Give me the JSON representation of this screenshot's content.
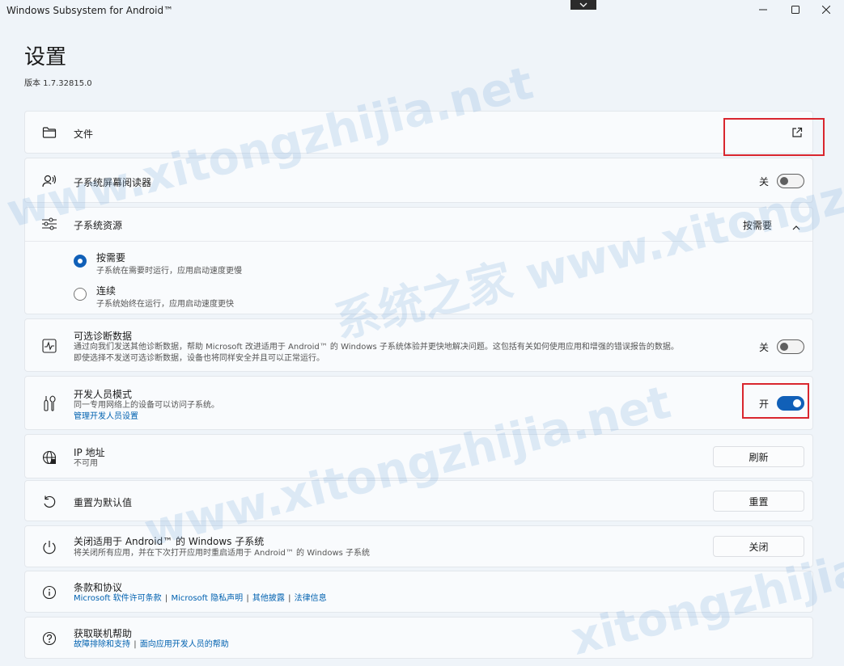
{
  "window": {
    "title": "Windows Subsystem for Android™",
    "controls": [
      "minimize-icon",
      "maximize-icon",
      "close-icon"
    ]
  },
  "header": {
    "title": "设置",
    "version": "版本 1.7.32815.0"
  },
  "files": {
    "label": "文件",
    "icon": "folder-icon",
    "action_icon": "open-external-icon"
  },
  "screen_reader": {
    "label": "子系统屏幕阅读器",
    "state_label": "关",
    "enabled": false
  },
  "resources": {
    "label": "子系统资源",
    "value": "按需要",
    "options": [
      {
        "label": "按需要",
        "desc": "子系统在需要时运行，应用启动速度更慢",
        "checked": true
      },
      {
        "label": "连续",
        "desc": "子系统始终在运行，应用启动速度更快",
        "checked": false
      }
    ]
  },
  "diagnostics": {
    "label": "可选诊断数据",
    "desc_line1": "通过向我们发送其他诊断数据，帮助 Microsoft 改进适用于 Android™ 的 Windows 子系统体验并更快地解决问题。这包括有关如何使用应用和增强的错误报告的数据。",
    "desc_line2": "即使选择不发送可选诊断数据，设备也将同样安全并且可以正常运行。",
    "state_label": "关",
    "enabled": false
  },
  "developer": {
    "label": "开发人员模式",
    "desc": "同一专用网络上的设备可以访问子系统。",
    "link": "管理开发人员设置",
    "state_label": "开",
    "enabled": true
  },
  "ip": {
    "label": "IP 地址",
    "value": "不可用",
    "button": "刷新"
  },
  "reset": {
    "label": "重置为默认值",
    "button": "重置"
  },
  "shutdown": {
    "label": "关闭适用于 Android™ 的 Windows 子系统",
    "desc": "将关闭所有应用，并在下次打开应用时重启适用于 Android™ 的 Windows 子系统",
    "button": "关闭"
  },
  "terms": {
    "label": "条款和协议",
    "links": [
      "Microsoft 软件许可条款",
      "Microsoft 隐私声明",
      "其他披露",
      "法律信息"
    ],
    "separator": "|"
  },
  "help": {
    "label": "获取联机帮助",
    "links": [
      "故障排除和支持",
      "面向应用开发人员的帮助"
    ],
    "separator": "|"
  },
  "watermarks": [
    "www.xitongzhijia.net",
    "系统之家 www.xitongzhijia.net",
    "www.xitongzhijia.net",
    "xitongzhijia.net"
  ],
  "colors": {
    "accent": "#1160b8",
    "highlight": "#d9262e",
    "link": "#0061b0"
  }
}
